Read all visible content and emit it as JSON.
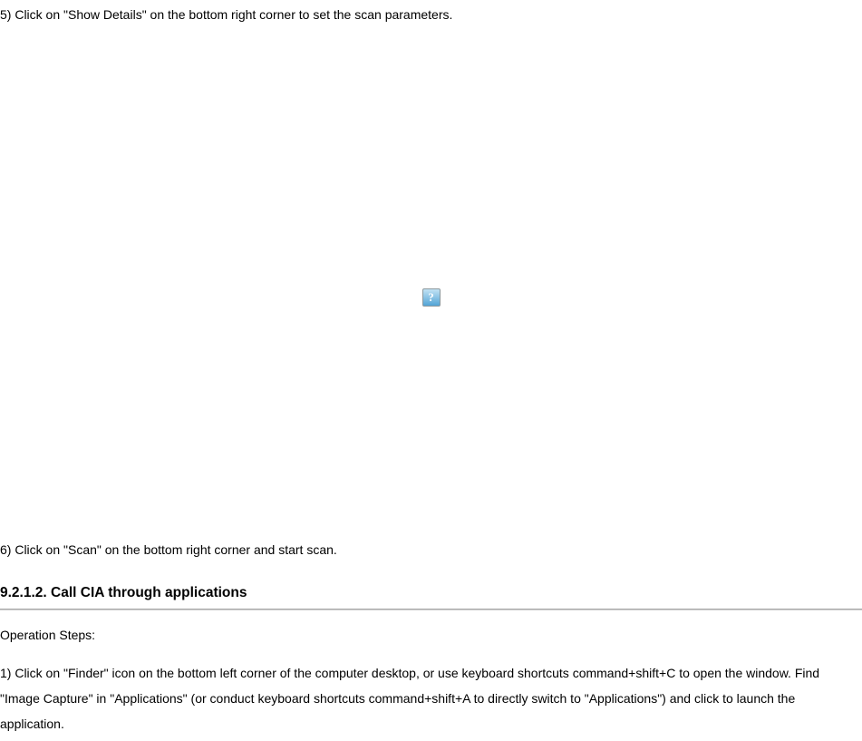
{
  "steps": {
    "step5": "5) Click on \"Show Details\" on the bottom right corner to set the scan parameters.",
    "step6": "6) Click on \"Scan\" on the bottom right corner and start scan."
  },
  "section": {
    "number": "9.2.1.2.",
    "title": "Call CIA through applications"
  },
  "operation": {
    "label": "Operation Steps:",
    "step1": "1) Click on \"Finder\" icon on the bottom left corner of the computer desktop, or use keyboard shortcuts command+shift+C to open the window. Find \"Image Capture\" in \"Applications\" (or conduct keyboard shortcuts command+shift+A to directly switch to \"Applications\") and click to launch the application."
  },
  "icon": {
    "questionMark": "?"
  }
}
